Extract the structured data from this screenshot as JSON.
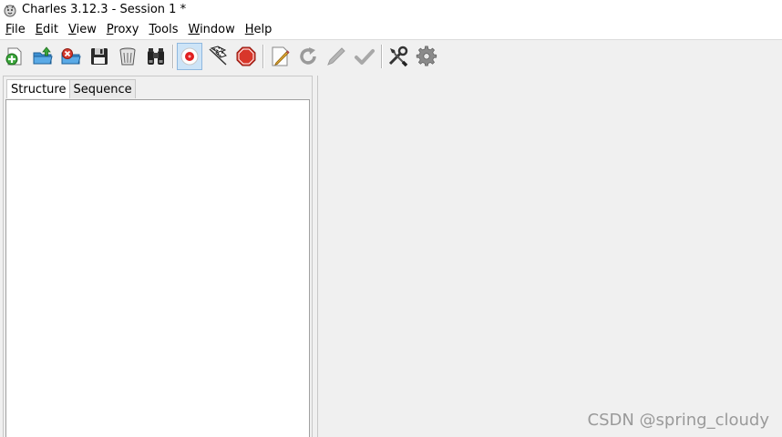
{
  "window": {
    "title": "Charles 3.12.3 - Session 1 *"
  },
  "menu": [
    {
      "mnemonic": "F",
      "rest": "ile"
    },
    {
      "mnemonic": "E",
      "rest": "dit"
    },
    {
      "mnemonic": "V",
      "rest": "iew"
    },
    {
      "mnemonic": "P",
      "rest": "roxy"
    },
    {
      "mnemonic": "T",
      "rest": "ools"
    },
    {
      "mnemonic": "W",
      "rest": "indow"
    },
    {
      "mnemonic": "H",
      "rest": "elp"
    }
  ],
  "toolbar": {
    "icons": [
      "new-session",
      "open-session",
      "close-session",
      "save-session",
      "clear-session",
      "find",
      "record",
      "throttle",
      "breakpoints",
      "edit",
      "repeat",
      "validate",
      "tools",
      "settings"
    ],
    "active": "record"
  },
  "tabs": {
    "structure": "Structure",
    "sequence": "Sequence",
    "selected": "Structure"
  },
  "watermark": "CSDN @spring_cloudy"
}
